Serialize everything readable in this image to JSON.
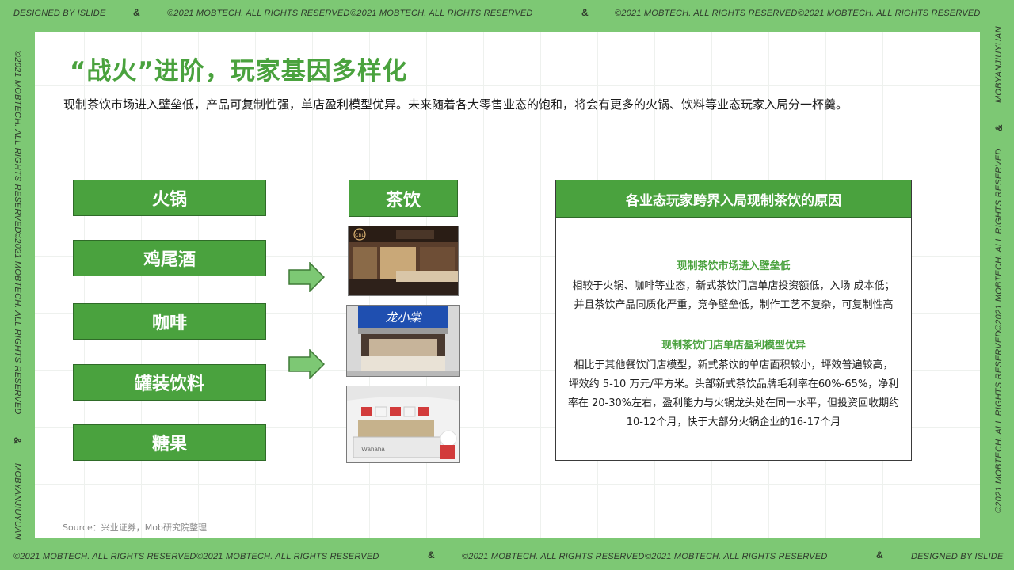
{
  "frame": {
    "top": [
      "DESIGNED BY ISLIDE",
      "&",
      "©2021 MOBTECH. ALL RIGHTS RESERVED",
      "©2021 MOBTECH. ALL RIGHTS RESERVED",
      "&",
      "©2021 MOBTECH. ALL RIGHTS RESERVED",
      "©2021 MOBTECH. ALL RIGHTS RESERVED"
    ],
    "bottom": [
      "©2021 MOBTECH. ALL RIGHTS RESERVED",
      "©2021 MOBTECH. ALL RIGHTS RESERVED",
      "&",
      "©2021 MOBTECH. ALL RIGHTS RESERVED",
      "©2021 MOBTECH. ALL RIGHTS RESERVED",
      "&",
      "DESIGNED BY ISLIDE"
    ],
    "left": [
      "©2021 MOBTECH. ALL RIGHTS RESERVED",
      "©2021 MOBTECH. ALL RIGHTS RESERVED",
      "&",
      "MOBYANJIUYUAN"
    ],
    "right": [
      "MOBYANJIUYUAN",
      "&",
      "©2021 MOBTECH. ALL RIGHTS RESERVED",
      "©2021 MOBTECH. ALL RIGHTS RESERVED"
    ]
  },
  "title": "“战火”进阶，玩家基因多样化",
  "subtitle": "现制茶饮市场进入壁垒低，产品可复制性强，单店盈利模型优异。未来随着各大零售业态的饱和，将会有更多的火锅、饮料等业态玩家入局分一杯羹。",
  "categories": [
    "火锅",
    "鸡尾酒",
    "咖啡",
    "罐装饮料",
    "糖果"
  ],
  "tea_label": "茶饮",
  "store_signs": [
    "CBL",
    "龙小棠",
    "Wahaha"
  ],
  "reasons": {
    "header": "各业态玩家跨界入局现制茶饮的原因",
    "sections": [
      {
        "title": "现制茶饮市场进入壁垒低",
        "lines": [
          "相较于火锅、咖啡等业态，新式茶饮门店单店投资额低，入场 成本低；",
          "并且茶饮产品同质化严重，竞争壁垒低，制作工艺不复杂，可复制性高"
        ]
      },
      {
        "title": "现制茶饮门店单店盈利模型优异",
        "lines": [
          "相比于其他餐饮门店模型，新式茶饮的单店面积较小，坪效普遍较高，",
          "坪效约 5-10 万元/平方米。头部新式茶饮品牌毛利率在60%-65%，净利",
          "率在 20-30%左右，盈利能力与火锅龙头处在同一水平，但投资回收期约",
          "10-12个月，快于大部分火锅企业的16-17个月"
        ]
      }
    ]
  },
  "source": "Source：兴业证券，Mob研究院整理",
  "colors": {
    "accent": "#4aa23e",
    "frame": "#7dc874"
  }
}
